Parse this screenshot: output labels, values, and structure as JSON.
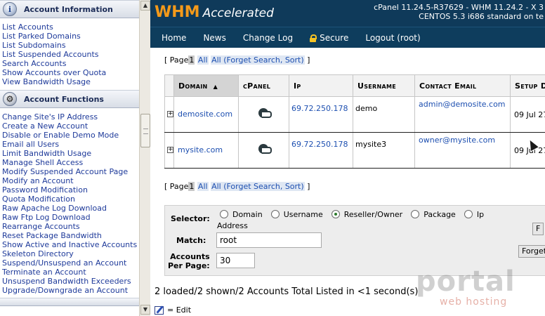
{
  "nav": {
    "account_information": {
      "title": "Account Information",
      "items": [
        "List Accounts",
        "List Parked Domains",
        "List Subdomains",
        "List Suspended Accounts",
        "Search Accounts",
        "Show Accounts over Quota",
        "View Bandwidth Usage"
      ]
    },
    "account_functions": {
      "title": "Account Functions",
      "items": [
        "Change Site's IP Address",
        "Create a New Account",
        "Disable or Enable Demo Mode",
        "Email all Users",
        "Limit Bandwidth Usage",
        "Manage Shell Access",
        "Modify Suspended Account Page",
        "Modify an Account",
        "Password Modification",
        "Quota Modification",
        "Raw Apache Log Download",
        "Raw Ftp Log Download",
        "Rearrange Accounts",
        "Reset Package Bandwidth",
        "Show Active and Inactive Accounts",
        "Skeleton Directory",
        "Suspend/Unsuspend an Account",
        "Terminate an Account",
        "Unsuspend Bandwidth Exceeders",
        "Upgrade/Downgrade an Account"
      ]
    }
  },
  "header": {
    "logo_main": "WHM",
    "logo_sub": "Accelerated",
    "version_line1": "cPanel 11.24.5-R37629 - WHM 11.24.2 - X 3",
    "version_line2": "CENTOS 5.3 i686 standard on te"
  },
  "menu": {
    "home": "Home",
    "news": "News",
    "changelog": "Change Log",
    "secure": "Secure",
    "logout": "Logout (root)"
  },
  "pager": {
    "open": "[ Page",
    "current": "1",
    "all": "All",
    "all_forget": "All (Forget Search, Sort)",
    "close": "]"
  },
  "table": {
    "headers": {
      "domain": "Domain",
      "cpanel": "cPanel",
      "ip": "Ip",
      "username": "Username",
      "email": "Contact Email",
      "setup": "Setup D"
    },
    "rows": [
      {
        "domain": "demosite.com",
        "ip": "69.72.250.178",
        "username": "demo",
        "email": "admin@demosite.com",
        "setup": "09 Jul 27"
      },
      {
        "domain": "mysite.com",
        "ip": "69.72.250.178",
        "username": "mysite3",
        "email": "owner@mysite.com",
        "setup": "09 Jul 27"
      }
    ]
  },
  "search": {
    "selector_label": "Selector:",
    "options": [
      "Domain",
      "Username",
      "Reseller/Owner",
      "Package",
      "Ip"
    ],
    "options_wrap": "Address",
    "selected": "Reseller/Owner",
    "match_label": "Match:",
    "match_value": "root",
    "per_page_label_1": "Accounts",
    "per_page_label_2": "Per Page:",
    "per_page_value": "30",
    "find_button": "F",
    "forget_button": "Forget"
  },
  "summary": "2 loaded/2 shown/2 Accounts Total Listed in <1 second(s)",
  "legend": {
    "edit": "= Edit"
  },
  "watermark": {
    "top": "portal",
    "bottom": "web hosting"
  }
}
